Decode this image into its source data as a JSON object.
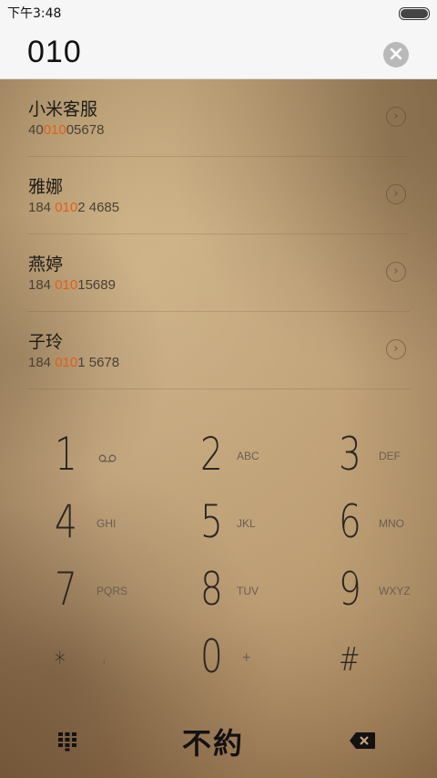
{
  "status": {
    "time": "下午3:48"
  },
  "dialer": {
    "number": "010"
  },
  "contacts": [
    {
      "name": "小米客服",
      "number_pre": "40",
      "number_hl": "010",
      "number_post": "05678"
    },
    {
      "name": "雅娜",
      "number_pre": "184 ",
      "number_hl": "010",
      "number_post": "2 4685"
    },
    {
      "name": "燕婷",
      "number_pre": "184 ",
      "number_hl": "010",
      "number_post": "15689"
    },
    {
      "name": "子玲",
      "number_pre": "184 ",
      "number_hl": "010",
      "number_post": "1 5678"
    }
  ],
  "keypad": [
    {
      "digit": "1",
      "letters": "",
      "icon": "voicemail-icon"
    },
    {
      "digit": "2",
      "letters": "ABC"
    },
    {
      "digit": "3",
      "letters": "DEF"
    },
    {
      "digit": "4",
      "letters": "GHI"
    },
    {
      "digit": "5",
      "letters": "JKL"
    },
    {
      "digit": "6",
      "letters": "MNO"
    },
    {
      "digit": "7",
      "letters": "PQRS"
    },
    {
      "digit": "8",
      "letters": "TUV"
    },
    {
      "digit": "9",
      "letters": "WXYZ"
    },
    {
      "digit": "*",
      "letters": ","
    },
    {
      "digit": "0",
      "letters": "+"
    },
    {
      "digit": "#",
      "letters": ""
    }
  ],
  "bottom": {
    "brand": "不約",
    "left_icon": "keypad-grid-icon",
    "right_icon": "backspace-icon"
  },
  "colors": {
    "highlight": "#e0601a",
    "topbar": "#f6f6f6",
    "paper": "#bfa07a"
  }
}
